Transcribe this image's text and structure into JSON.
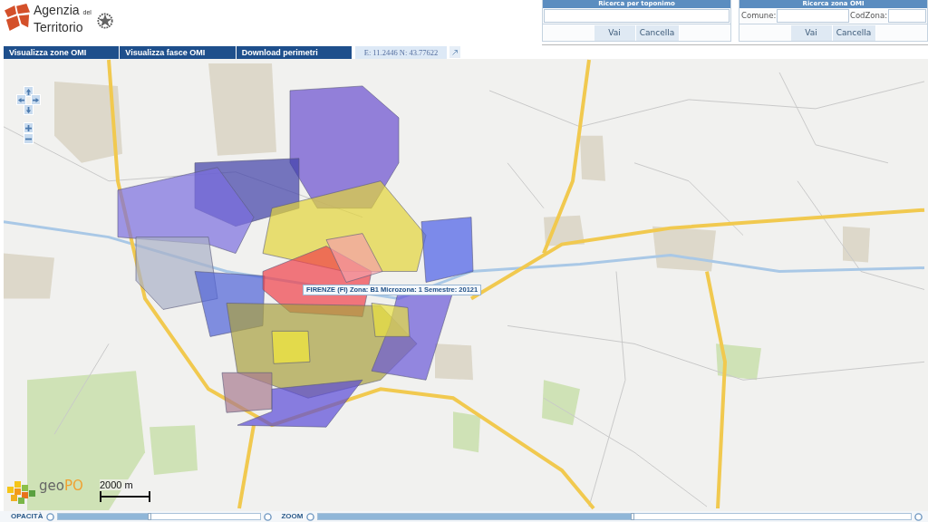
{
  "header": {
    "logo": {
      "line_1": "Agenzia",
      "line_1_suffix": "del",
      "line_2": "Territorio"
    }
  },
  "toponym_search": {
    "title": "Ricerca per toponimo",
    "buttons": [
      "Vai",
      "Cancella"
    ]
  },
  "zone_search": {
    "title": "Ricerca zona OMI",
    "fields": [
      {
        "label": "Comune:"
      },
      {
        "label": "CodZona:"
      }
    ],
    "buttons": [
      "Vai",
      "Cancella"
    ]
  },
  "tabs": [
    {
      "label": "Visualizza zone OMI"
    },
    {
      "label": "Visualizza fasce OMI"
    },
    {
      "label": "Download perimetri"
    }
  ],
  "coordinates": "E: 11.2446 N: 43.77622",
  "map": {
    "tooltip": "FIRENZE (FI) Zona: B1 Microzona: 1 Semestre: 20121",
    "logo_text": [
      "geo",
      "PO"
    ],
    "scale_label": "2000 m"
  },
  "bottom_bar": {
    "sliders": [
      {
        "label": "OPACITÀ",
        "level": 0.45
      },
      {
        "label": "ZOOM",
        "level": 0.53
      }
    ]
  }
}
